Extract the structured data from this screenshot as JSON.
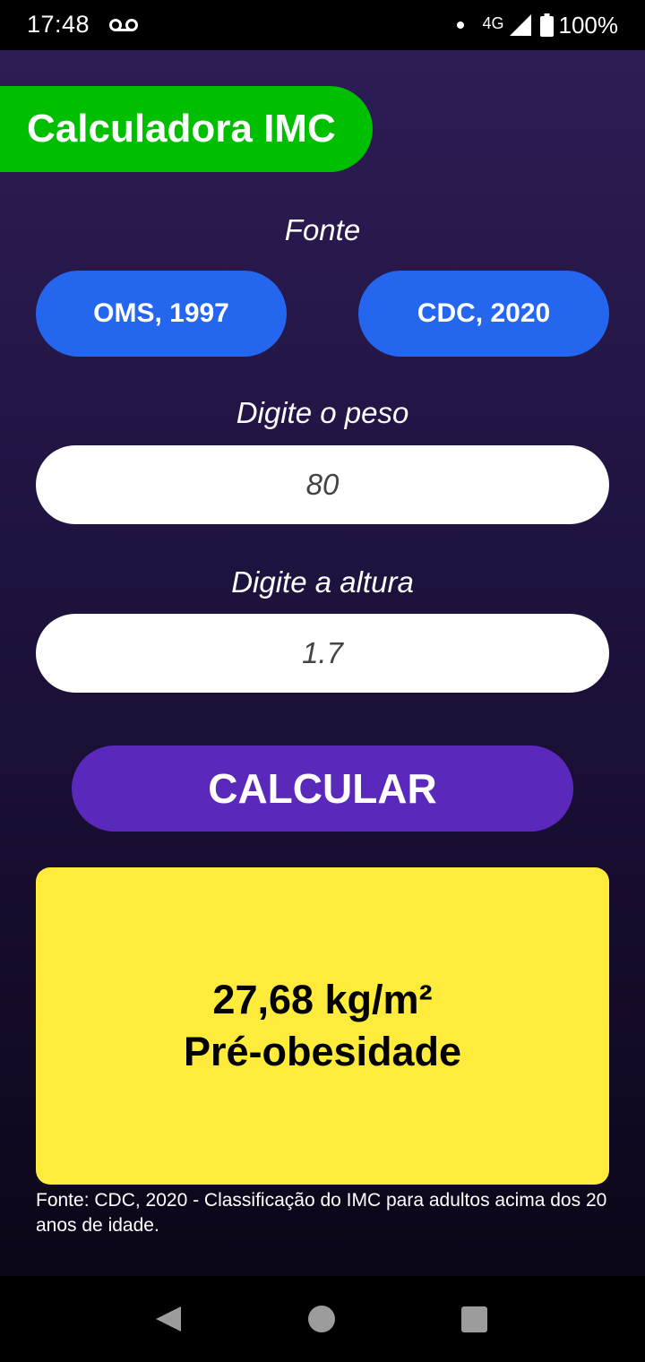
{
  "status_bar": {
    "time": "17:48",
    "network": "4G",
    "battery": "100%",
    "icons": [
      "voicemail-icon",
      "notification-dot-icon",
      "signal-icon",
      "battery-icon"
    ]
  },
  "app": {
    "title": "Calculadora IMC",
    "source_label": "Fonte",
    "source_options": [
      "OMS, 1997",
      "CDC, 2020"
    ],
    "weight_label": "Digite o peso",
    "weight_value": "80",
    "height_label": "Digite a altura",
    "height_value": "1.7",
    "calculate_label": "CALCULAR",
    "result": {
      "bmi": "27,68 kg/m²",
      "classification": "Pré-obesidade"
    },
    "footnote": "Fonte: CDC, 2020 - Classificação do IMC para adultos acima dos 20 anos de idade."
  },
  "navigation": {
    "icons": [
      "back-icon",
      "home-icon",
      "recents-icon"
    ]
  },
  "colors": {
    "title_pill": "#00bf00",
    "source_button": "#2566ee",
    "calculate_button": "#5a29bc",
    "result_card": "#ffeb3b"
  }
}
